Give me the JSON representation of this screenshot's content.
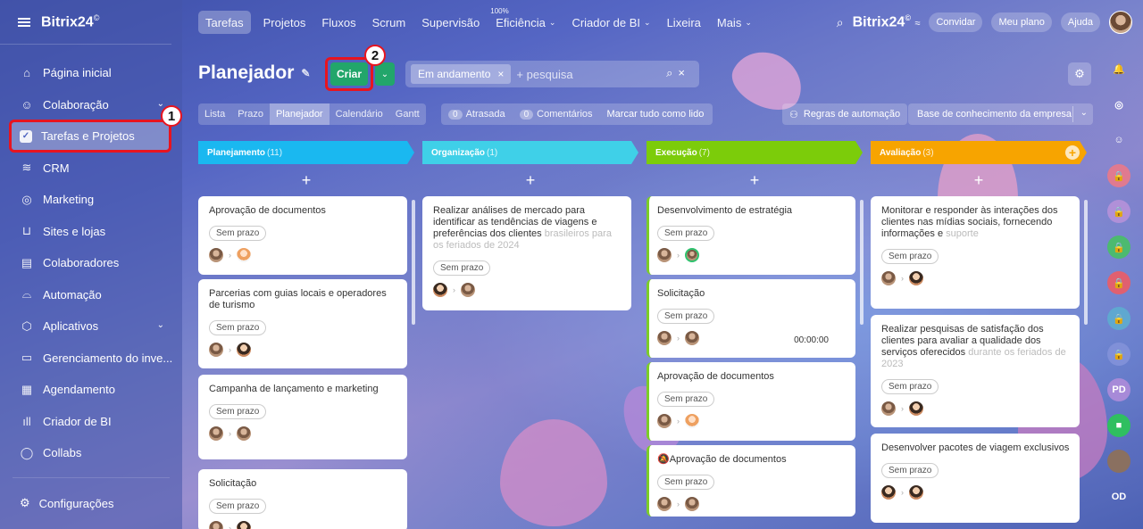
{
  "sidebar": {
    "logo": "Bitrix24",
    "logo_sup": "©",
    "items": [
      {
        "label": "Página inicial",
        "icon": "home-icon",
        "glyph": "⌂"
      },
      {
        "label": "Colaboração",
        "icon": "collab-icon",
        "glyph": "☺",
        "dropdown": true
      },
      {
        "label": "Tarefas e Projetos",
        "icon": "task-check-icon",
        "glyph": "✓",
        "active": true
      },
      {
        "label": "CRM",
        "icon": "crm-icon",
        "glyph": "≋"
      },
      {
        "label": "Marketing",
        "icon": "marketing-icon",
        "glyph": "◎"
      },
      {
        "label": "Sites e lojas",
        "icon": "cart-icon",
        "glyph": "⊔"
      },
      {
        "label": "Colaboradores",
        "icon": "people-card-icon",
        "glyph": "▤"
      },
      {
        "label": "Automação",
        "icon": "automation-icon",
        "glyph": "⌓"
      },
      {
        "label": "Aplicativos",
        "icon": "apps-cube-icon",
        "glyph": "⬡",
        "dropdown": true
      },
      {
        "label": "Gerenciamento do inve...",
        "icon": "inventory-icon",
        "glyph": "▭"
      },
      {
        "label": "Agendamento",
        "icon": "calendar-icon",
        "glyph": "▦"
      },
      {
        "label": "Criador de BI",
        "icon": "bi-chart-icon",
        "glyph": "ıll"
      },
      {
        "label": "Collabs",
        "icon": "collabs-icon",
        "glyph": "◯"
      }
    ],
    "settings_label": "Configurações"
  },
  "topnav": {
    "tabs": [
      {
        "label": "Tarefas",
        "active": true
      },
      {
        "label": "Projetos"
      },
      {
        "label": "Fluxos"
      },
      {
        "label": "Scrum"
      },
      {
        "label": "Supervisão"
      },
      {
        "label": "Eficiência",
        "badge": "100%",
        "dropdown": true
      },
      {
        "label": "Criador de BI",
        "dropdown": true
      },
      {
        "label": "Lixeira"
      },
      {
        "label": "Mais",
        "dropdown": true
      }
    ],
    "brand": "Bitrix24",
    "brand_sup": "©",
    "invite": "Convidar",
    "plan": "Meu plano",
    "help": "Ajuda"
  },
  "page": {
    "title": "Planejador",
    "create_label": "Criar",
    "filter_chip": "Em andamento",
    "search_placeholder": "+ pesquisa"
  },
  "views": [
    "Lista",
    "Prazo",
    "Planejador",
    "Calendário",
    "Gantt"
  ],
  "active_view": "Planejador",
  "counters": {
    "overdue_count": "0",
    "overdue_label": "Atrasada",
    "comments_count": "0",
    "comments_label": "Comentários",
    "mark_read": "Marcar tudo como lido"
  },
  "automation_label": "Regras de automação",
  "knowledge_base_label": "Base de conhecimento da empresa",
  "annotations": {
    "one": "1",
    "two": "2"
  },
  "columns": [
    {
      "name": "Planejamento",
      "count": "(11)",
      "color": "#1ab8f0"
    },
    {
      "name": "Organização",
      "count": "(1)",
      "color": "#3fd0e8"
    },
    {
      "name": "Execução",
      "count": "(7)",
      "color": "#7ccc0a"
    },
    {
      "name": "Avaliação",
      "count": "(3)",
      "color": "#f7a400"
    }
  ],
  "cards": {
    "planning": [
      {
        "title": "Aprovação de documentos",
        "deadline": "Sem prazo"
      },
      {
        "title": "Parcerias com guias locais e operadores de turismo",
        "deadline": "Sem prazo"
      },
      {
        "title": "Campanha de lançamento e marketing",
        "deadline": "Sem prazo"
      },
      {
        "title": "Solicitação",
        "deadline": "Sem prazo"
      }
    ],
    "organization": [
      {
        "title": "Realizar análises de mercado para identificar as tendências de viagens e preferências dos clientes",
        "title_fade": "brasileiros para os feriados de 2024",
        "deadline": "Sem prazo"
      }
    ],
    "execution": [
      {
        "title": "Desenvolvimento de estratégia",
        "deadline": "Sem prazo"
      },
      {
        "title": "Solicitação",
        "deadline": "Sem prazo",
        "timer": "00:00:00"
      },
      {
        "title": "Aprovação de documentos",
        "deadline": "Sem prazo"
      },
      {
        "title": "Aprovação de documentos",
        "deadline": "Sem prazo",
        "muted": true
      }
    ],
    "evaluation": [
      {
        "title": "Monitorar e responder às interações dos clientes nas mídias sociais, fornecendo informações e",
        "title_fade": "suporte",
        "deadline": "Sem prazo"
      },
      {
        "title": "Realizar pesquisas de satisfação dos clientes para avaliar a qualidade dos serviços oferecidos",
        "title_fade": "durante os feriados de 2023",
        "deadline": "Sem prazo"
      },
      {
        "title": "Desenvolver pacotes de viagem exclusivos",
        "deadline": "Sem prazo"
      }
    ]
  },
  "rail": [
    "bell-icon",
    "target-icon",
    "chat-icon",
    "lock-icon",
    "lock-icon",
    "lock-icon",
    "lock-icon",
    "lock-icon",
    "lock-icon",
    "PD",
    "video-icon",
    "avatar",
    "OD"
  ],
  "rail_labels": {
    "pd": "PD",
    "od": "OD"
  }
}
